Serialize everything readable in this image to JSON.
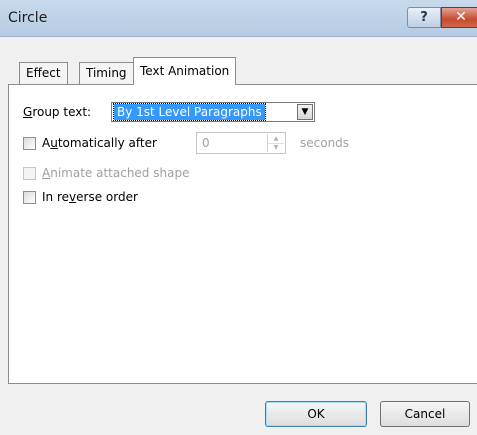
{
  "window": {
    "title": "Circle",
    "help_label": "?",
    "close_label": "✕"
  },
  "tabs": [
    {
      "label": "Effect"
    },
    {
      "label": "Timing"
    },
    {
      "label": "Text Animation",
      "active": true
    }
  ],
  "group_text": {
    "label_prefix": "G",
    "label_rest": "roup text:",
    "value": "By 1st Level Paragraphs"
  },
  "auto_after": {
    "label_prefix": "A",
    "label_mid": "u",
    "label_rest": "tomatically after",
    "checked": false,
    "value": "0",
    "unit": "seconds"
  },
  "animate_shape": {
    "label_u": "A",
    "label_rest": "nimate attached shape",
    "checked": false,
    "disabled": true
  },
  "reverse_order": {
    "label_pre": "In re",
    "label_u": "v",
    "label_rest": "erse order",
    "checked": false
  },
  "buttons": {
    "ok": "OK",
    "cancel": "Cancel"
  }
}
